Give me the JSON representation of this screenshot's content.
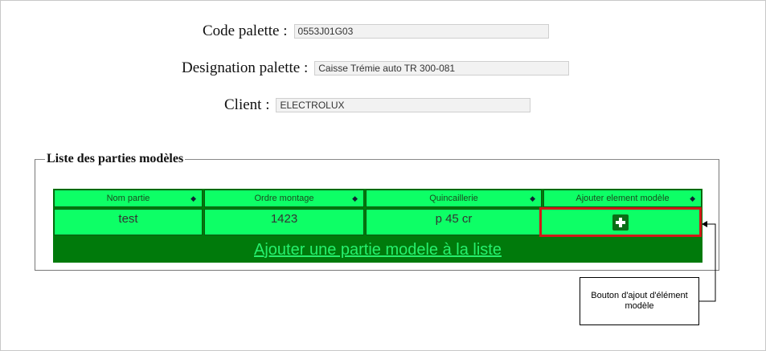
{
  "form": {
    "code": {
      "label": "Code palette :",
      "value": "0553J01G03"
    },
    "designation": {
      "label": "Designation palette :",
      "value": "Caisse Trémie auto TR 300-081"
    },
    "client": {
      "label": "Client :",
      "value": "ELECTROLUX"
    }
  },
  "list": {
    "title": "Liste des parties modèles",
    "columns": [
      "Nom partie",
      "Ordre montage",
      "Quincaillerie",
      "Ajouter element modèle"
    ],
    "rows": [
      {
        "nom": "test",
        "ordre": "1423",
        "quincaillerie": "p 45 cr"
      }
    ],
    "add_link": "Ajouter une partie modele à la liste"
  },
  "annotation": {
    "text": "Bouton d'ajout d'élément modèle"
  },
  "colors": {
    "header_bg": "#0dff66",
    "grid_bg": "#007a0b",
    "highlight": "#d01818"
  }
}
